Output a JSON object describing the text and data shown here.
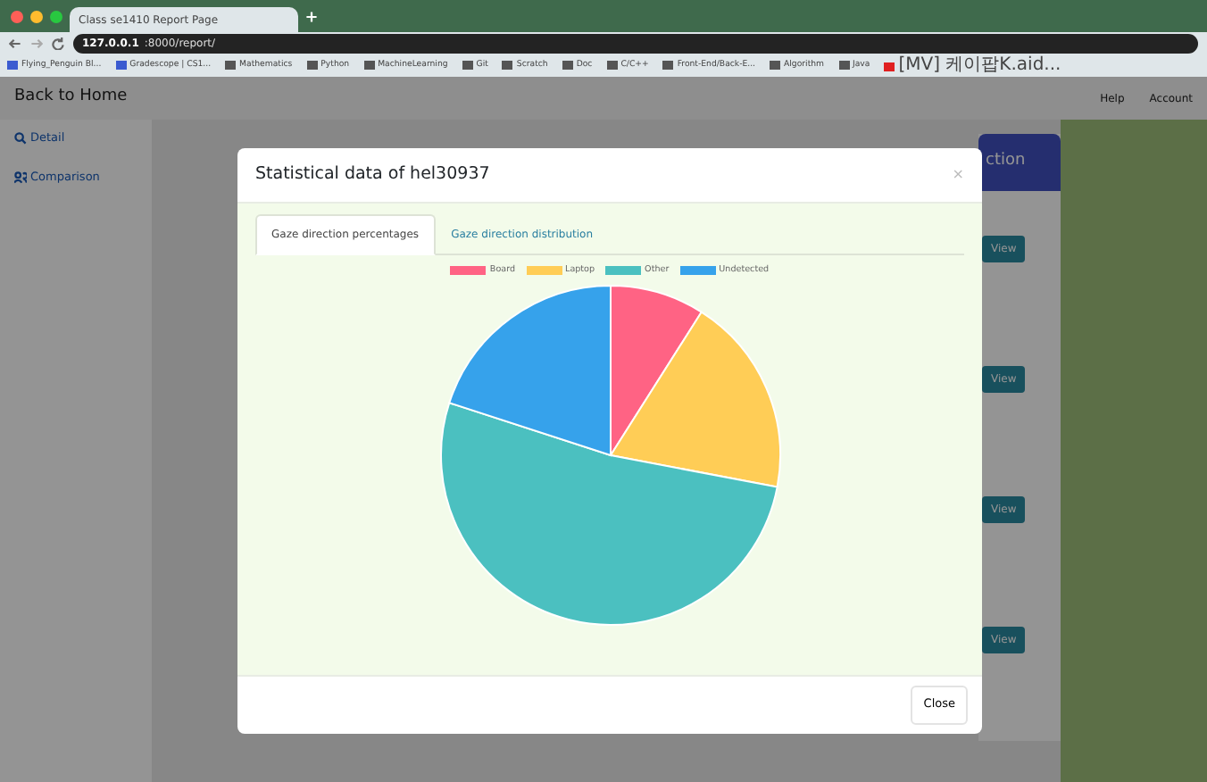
{
  "browser": {
    "tab_title": "Class se1410 Report Page",
    "url_host": "127.0.0.1",
    "url_rest": ":8000/report/",
    "bookmarks": [
      {
        "label": "Flying_Penguin Bl...",
        "kind": "page"
      },
      {
        "label": "Gradescope | CS1...",
        "kind": "page"
      },
      {
        "label": "Mathematics",
        "kind": "folder"
      },
      {
        "label": "Python",
        "kind": "folder"
      },
      {
        "label": "MachineLearning",
        "kind": "folder"
      },
      {
        "label": "Git",
        "kind": "folder"
      },
      {
        "label": "Scratch",
        "kind": "folder"
      },
      {
        "label": "Doc",
        "kind": "folder"
      },
      {
        "label": "C/C++",
        "kind": "folder"
      },
      {
        "label": "Front-End/Back-E...",
        "kind": "folder"
      },
      {
        "label": "Algorithm",
        "kind": "folder"
      },
      {
        "label": "Java",
        "kind": "folder"
      },
      {
        "label": "[MV] 케이팝K.aid...",
        "kind": "video"
      }
    ]
  },
  "navbar": {
    "brand": "Back to Home",
    "help": "Help",
    "account": "Account"
  },
  "sidebar": {
    "items": [
      {
        "label": "Detail"
      },
      {
        "label": "Comparison"
      }
    ]
  },
  "card": {
    "header": "ction",
    "buttons": [
      "View",
      "View",
      "View",
      "View"
    ]
  },
  "modal": {
    "title": "Statistical data of hel30937",
    "close_x": "×",
    "tabs": [
      {
        "label": "Gaze direction percentages",
        "selected": true
      },
      {
        "label": "Gaze direction distribution",
        "selected": false
      }
    ],
    "chart_data": {
      "type": "pie",
      "categories": [
        "Board",
        "Laptop",
        "Other",
        "Undetected"
      ],
      "values": [
        9,
        19,
        52,
        20
      ],
      "colors": [
        "#ff6384",
        "#ffcd56",
        "#4bc0c0",
        "#36a2eb"
      ]
    },
    "close_button": "Close"
  }
}
